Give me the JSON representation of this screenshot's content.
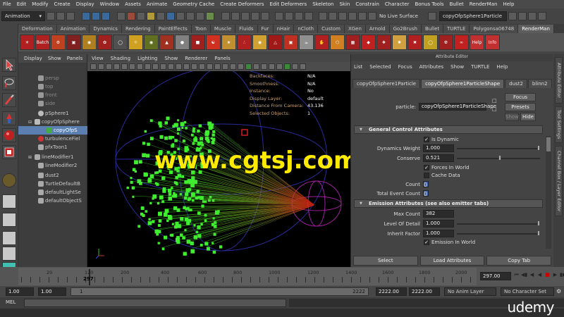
{
  "menubar": [
    "File",
    "Edit",
    "Modify",
    "Create",
    "Display",
    "Window",
    "Assets",
    "Animate",
    "Geometry Cache",
    "Create Deformers",
    "Edit Deformers",
    "Skeleton",
    "Skin",
    "Constrain",
    "Character",
    "Bonus Tools",
    "Bullet",
    "RenderMan",
    "Help"
  ],
  "statusline": {
    "menuset": "Animation",
    "render_label": "No Live Surface",
    "selection_field": "copyOfpSphere1Particle"
  },
  "shelf_tabs": [
    "Deformation",
    "Animation",
    "Dynamics",
    "Rendering",
    "PaintEffects",
    "Toon",
    "Muscle",
    "Fluids",
    "Fur",
    "nHair",
    "nCloth",
    "Custom",
    "XGen",
    "Arnold",
    "Go2Brush",
    "Bullet",
    "TURTLE",
    "Polygonsa06748",
    "RenderMan"
  ],
  "shelf_active": "RenderMan",
  "shelf_icon_labels": [
    "Batch",
    "Help",
    "Info"
  ],
  "outliner": {
    "menu": [
      "Display",
      "Show",
      "Panels"
    ],
    "items": [
      "persp",
      "top",
      "front",
      "side",
      "pSphere1",
      "copyOfpSphere",
      "copyOfpS",
      "turbulenceFiel",
      "pfxToon1",
      "lineModifier1",
      "lineModifier2",
      "dust2",
      "TurtleDefaultB",
      "defaultLightSe",
      "defaultObjectS"
    ]
  },
  "viewport": {
    "menu": [
      "View",
      "Shading",
      "Lighting",
      "Show",
      "Renderer",
      "Panels"
    ],
    "hud": [
      {
        "label": "Backfaces:",
        "value": "N/A"
      },
      {
        "label": "Smoothness:",
        "value": "N/A"
      },
      {
        "label": "Instance:",
        "value": "No"
      },
      {
        "label": "Display Layer:",
        "value": "default"
      },
      {
        "label": "Distance From Camera:",
        "value": "43.136"
      },
      {
        "label": "Selected Objects:",
        "value": "1"
      }
    ],
    "watermark": "www.cgtsj.com"
  },
  "attribute_editor": {
    "title": "Attribute Editor",
    "menu": [
      "List",
      "Selected",
      "Focus",
      "Attributes",
      "Show",
      "TURTLE",
      "Help"
    ],
    "tabs": [
      "copyOfpSphere1Particle",
      "copyOfpSphere1ParticleShape",
      "dust2",
      "blinn2"
    ],
    "active_tab": "copyOfpSphere1ParticleShape",
    "node_label": "particle:",
    "node_value": "copyOfpSphere1ParticleShape",
    "focus_btn": "Focus",
    "presets_btn": "Presets",
    "show_btn": "Show",
    "hide_btn": "Hide",
    "general_section": "General Control Attributes",
    "is_dynamic": "Is Dynamic",
    "dynamics_weight_label": "Dynamics Weight",
    "dynamics_weight": "1.000",
    "conserve_label": "Conserve",
    "conserve": "0.521",
    "forces_in_world": "Forces In World",
    "cache_data": "Cache Data",
    "count_label": "Count",
    "count": "0",
    "total_event_count_label": "Total Event Count",
    "total_event_count": "0",
    "emission_section": "Emission Attributes (see also emitter tabs)",
    "max_count_label": "Max Count",
    "max_count": "382",
    "level_of_detail_label": "Level Of Detail",
    "level_of_detail": "1.000",
    "inherit_factor_label": "Inherit Factor",
    "inherit_factor": "1.000",
    "emission_in_world": "Emission In World",
    "select_btn": "Select",
    "load_btn": "Load Attributes",
    "copy_btn": "Copy Tab"
  },
  "side_tabs": [
    "Attribute Editor",
    "Tool Settings",
    "Channel Box / Layer Editor"
  ],
  "timeline": {
    "ticks": [
      "20",
      "120",
      "200",
      "400",
      "600",
      "800",
      "1000",
      "1200",
      "1400",
      "1600",
      "1800",
      "2000",
      "2200"
    ],
    "current_frame": "297",
    "current_field": "297.00"
  },
  "range": {
    "start": "1.00",
    "playback_start": "1.00",
    "bar_start": "1",
    "bar_end": "2222",
    "playback_end": "2222.00",
    "end": "2222.00",
    "anim_layer": "No Anim Layer",
    "character_set": "No Character Set"
  },
  "cmdline": {
    "label": "MEL"
  },
  "branding": "udemy"
}
